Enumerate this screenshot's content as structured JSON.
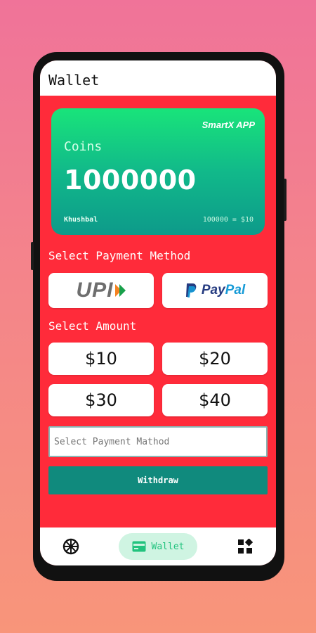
{
  "app": {
    "title": "Wallet"
  },
  "card": {
    "brand": "SmartX APP",
    "coins_label": "Coins",
    "coins_value": "1000000",
    "holder": "Khushbal",
    "rate": "100000 = $10"
  },
  "payment": {
    "title": "Select Payment Method",
    "methods": [
      {
        "label": "UPI",
        "icon": "upi-logo"
      },
      {
        "label": "PayPal",
        "icon": "paypal-logo",
        "colors": {
          "pay": "#253b80",
          "pal": "#179bd7"
        }
      }
    ]
  },
  "amount": {
    "title": "Select Amount",
    "options": [
      "$10",
      "$20",
      "$30",
      "$40"
    ]
  },
  "input": {
    "placeholder": "Select Payment Mathod"
  },
  "withdraw": {
    "label": "Withdraw"
  },
  "nav": {
    "items": [
      {
        "icon": "wheel-icon"
      },
      {
        "icon": "wallet-icon",
        "label": "Wallet",
        "active": true
      },
      {
        "icon": "grid-icon"
      }
    ]
  },
  "colors": {
    "screen_bg": "#ff2b3a",
    "accent": "#108a7d",
    "card_gradient": [
      "#19e47a",
      "#0d9a8a"
    ],
    "nav_active_bg": "#cff4e2",
    "nav_active_text": "#22c37e"
  }
}
